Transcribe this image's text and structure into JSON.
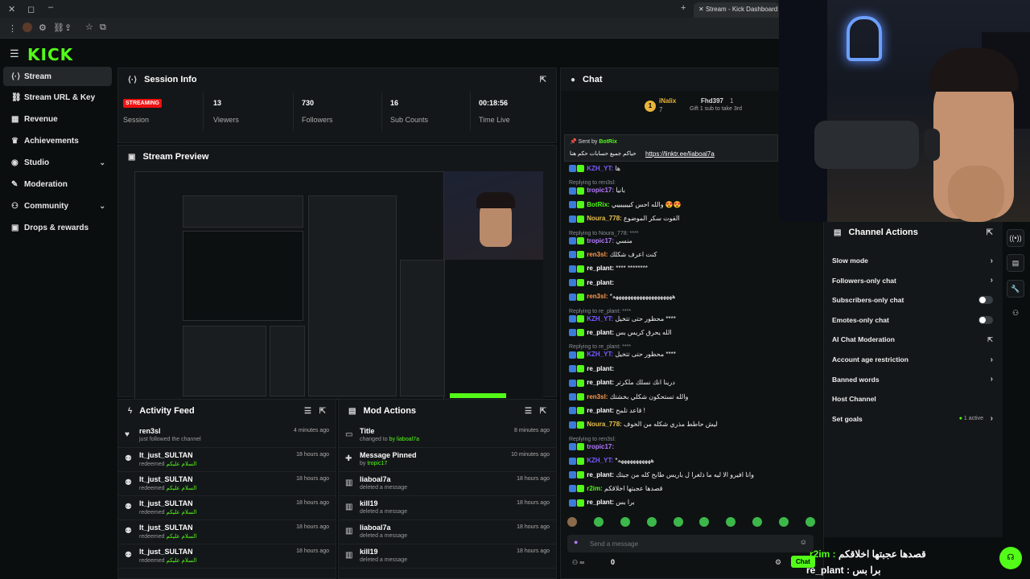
{
  "browser": {
    "tab_title": "Stream - Kick Dashboard"
  },
  "logo": "KICK",
  "nav": [
    {
      "label": "Stream",
      "icon": "stream-icon"
    },
    {
      "label": "Stream URL & Key",
      "icon": "link-icon"
    },
    {
      "label": "Revenue",
      "icon": "revenue-icon"
    },
    {
      "label": "Achievements",
      "icon": "trophy-icon"
    },
    {
      "label": "Studio",
      "icon": "studio-icon"
    },
    {
      "label": "Moderation",
      "icon": "wrench-icon"
    },
    {
      "label": "Community",
      "icon": "community-icon"
    },
    {
      "label": "Drops & rewards",
      "icon": "gift-icon"
    }
  ],
  "session": {
    "title": "Session Info",
    "live": "STREAMING",
    "live_label": "Session",
    "stats": [
      {
        "value": "13",
        "label": "Viewers"
      },
      {
        "value": "730",
        "label": "Followers"
      },
      {
        "value": "16",
        "label": "Sub Counts"
      },
      {
        "value": "00:18:56",
        "label": "Time Live"
      }
    ]
  },
  "preview": {
    "title": "Stream Preview"
  },
  "activity": {
    "title": "Activity Feed",
    "rows": [
      {
        "name": "ren3sl",
        "desc": "just followed the channel",
        "extra": "",
        "time": "4 minutes ago",
        "icon": "heart-icon"
      },
      {
        "name": "lt_just_SULTAN",
        "desc": "redeemed ",
        "extra": "السلام عليكم",
        "time": "18 hours ago",
        "icon": "redeem-icon"
      },
      {
        "name": "lt_just_SULTAN",
        "desc": "redeemed ",
        "extra": "السلام عليكم",
        "time": "18 hours ago",
        "icon": "redeem-icon"
      },
      {
        "name": "lt_just_SULTAN",
        "desc": "redeemed ",
        "extra": "السلام عليكم",
        "time": "18 hours ago",
        "icon": "redeem-icon"
      },
      {
        "name": "lt_just_SULTAN",
        "desc": "redeemed ",
        "extra": "السلام عليكم",
        "time": "18 hours ago",
        "icon": "redeem-icon"
      },
      {
        "name": "lt_just_SULTAN",
        "desc": "redeemed ",
        "extra": "السلام عليكم",
        "time": "18 hours ago",
        "icon": "redeem-icon"
      }
    ]
  },
  "mod": {
    "title": "Mod Actions",
    "rows": [
      {
        "name": "Title",
        "desc": "changed to ",
        "extra": "by liaboal7a",
        "time": "8 minutes ago",
        "icon": "title-icon"
      },
      {
        "name": "Message Pinned",
        "desc": "by ",
        "extra": "tropic17",
        "time": "10 minutes ago",
        "icon": "pin-icon"
      },
      {
        "name": "liaboal7a",
        "desc": "deleted a message",
        "extra": "",
        "time": "18 hours ago",
        "icon": "trash-icon"
      },
      {
        "name": "kill19",
        "desc": "deleted a message",
        "extra": "",
        "time": "18 hours ago",
        "icon": "trash-icon"
      },
      {
        "name": "liaboal7a",
        "desc": "deleted a message",
        "extra": "",
        "time": "18 hours ago",
        "icon": "trash-icon"
      },
      {
        "name": "kill19",
        "desc": "deleted a message",
        "extra": "",
        "time": "18 hours ago",
        "icon": "trash-icon"
      }
    ]
  },
  "chat": {
    "title": "Chat",
    "top_gifter": {
      "rank": "1",
      "name": "iNalix",
      "count": "7",
      "name2": "Fhd397",
      "count2": "1",
      "gift": "Gift 1 sub to take 3rd"
    },
    "pinned": {
      "sent_by": "Sent by",
      "bot": "BotRix",
      "text": "حياكم جميع حسابات حكم هنا",
      "link": "https://linktr.ee/liaboal7a"
    },
    "lines": [
      {
        "reply": "",
        "user": "KZH_YT:",
        "color": "#7b5cff",
        "text": "ها"
      },
      {
        "reply": "Replying to ren3sl:",
        "user": "tropic17:",
        "color": "#b57bff",
        "text": "بانيا"
      },
      {
        "reply": "",
        "user": "BotRix:",
        "color": "#53fc18",
        "text": "والله احس كيييييييي 😍😍"
      },
      {
        "reply": "",
        "user": "Noura_778:",
        "color": "#e8c14b",
        "text": "الفوت سكر الموضوع"
      },
      {
        "reply": "Replying to Noura_778: ****",
        "user": "tropic17:",
        "color": "#b57bff",
        "text": "منسي"
      },
      {
        "reply": "",
        "user": "ren3sl:",
        "color": "#ff9a4b",
        "text": "كنت اعرف شكلك"
      },
      {
        "reply": "",
        "user": "re_plant:",
        "color": "#ffffff",
        "text": "**** ********"
      },
      {
        "reply": "",
        "user": "re_plant:",
        "color": "#ffffff",
        "text": ""
      },
      {
        "reply": "",
        "user": "ren3sl:",
        "color": "#ff9a4b",
        "text": "*ههههههههههههههههههههه"
      },
      {
        "reply": "Replying to re_plant: ****",
        "user": "KZH_YT:",
        "color": "#7b5cff",
        "text": "محظور حتى تتخيل ****"
      },
      {
        "reply": "",
        "user": "re_plant:",
        "color": "#ffffff",
        "text": "الله يحرق كريس بس"
      },
      {
        "reply": "Replying to re_plant: ****",
        "user": "KZH_YT:",
        "color": "#7b5cff",
        "text": "محظور حتى تتخيل ****"
      },
      {
        "reply": "",
        "user": "re_plant:",
        "color": "#ffffff",
        "text": ""
      },
      {
        "reply": "",
        "user": "re_plant:",
        "color": "#ffffff",
        "text": "درينا انك نسلك ملكرتر"
      },
      {
        "reply": "",
        "user": "ren3sl:",
        "color": "#ff9a4b",
        "text": "والله تستحكون شكلي بخشتك"
      },
      {
        "reply": "",
        "user": "re_plant:",
        "color": "#ffffff",
        "text": "قاعد تلمح !"
      },
      {
        "reply": "",
        "user": "Noura_778:",
        "color": "#e8c14b",
        "text": "ليش حاطط مذري شكله من الخوف"
      },
      {
        "reply": "Replying to ren3sl:",
        "user": "tropic17:",
        "color": "#b57bff",
        "text": ""
      },
      {
        "reply": "",
        "user": "KZH_YT:",
        "color": "#7b5cff",
        "text": "*هههههههههههه"
      },
      {
        "reply": "",
        "user": "re_plant:",
        "color": "#ffffff",
        "text": "وانا افيرو الا ليه ما ذلغرا ل باريس طابح كله من جيتك"
      },
      {
        "reply": "",
        "user": "r2im:",
        "color": "#53fc18",
        "text": "قصدها عجبتها اخلاقكم"
      },
      {
        "reply": "",
        "user": "re_plant:",
        "color": "#ffffff",
        "text": "برا بس"
      }
    ],
    "input_placeholder": "Send a message",
    "count": "0",
    "send_label": "Chat"
  },
  "channel_actions": {
    "title": "Channel Actions",
    "items": [
      {
        "label": "Slow mode",
        "kind": "chevron"
      },
      {
        "label": "Followers-only chat",
        "kind": "chevron"
      },
      {
        "label": "Subscribers-only chat",
        "kind": "toggle"
      },
      {
        "label": "Emotes-only chat",
        "kind": "toggle"
      },
      {
        "label": "AI Chat Moderation",
        "kind": "external"
      },
      {
        "label": "Account age restriction",
        "kind": "chevron"
      },
      {
        "label": "Banned words",
        "kind": "chevron"
      },
      {
        "label": "Host Channel",
        "kind": "none"
      },
      {
        "label": "Set goals",
        "kind": "chevron"
      }
    ],
    "goals_active": "1 active"
  },
  "overlay": {
    "line1_user": "r2im :",
    "line1_text": "قصدها عجبتها اخلاقكم",
    "line2_user": "re_plant :",
    "line2_text": "برا بس"
  },
  "colors": {
    "brand": "#53fc18",
    "live": "#e11111"
  }
}
